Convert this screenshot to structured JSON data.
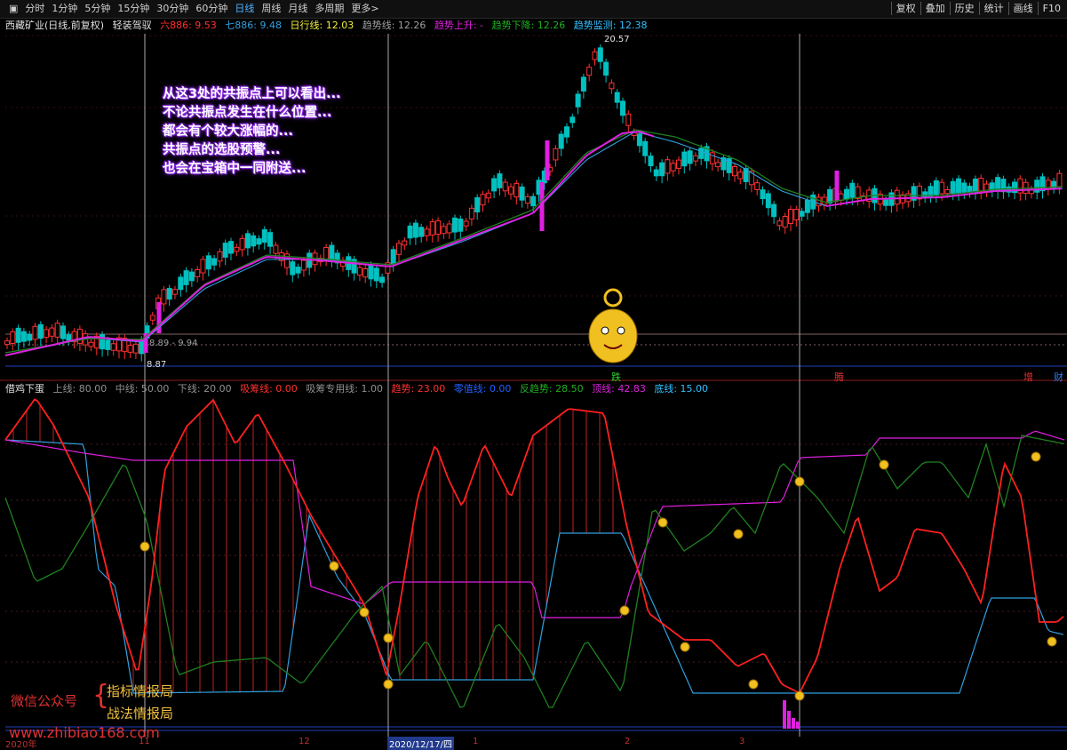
{
  "toolbar": {
    "items": [
      "分时",
      "1分钟",
      "5分钟",
      "15分钟",
      "30分钟",
      "60分钟",
      "日线",
      "周线",
      "月线",
      "多周期",
      "更多>"
    ],
    "active_index": 6,
    "right": [
      "复权",
      "叠加",
      "历史",
      "统计",
      "画线",
      "F10"
    ],
    "window_icon": "window-icon"
  },
  "upper_header": {
    "stock": "西藏矿业(日线,前复权)",
    "indicator": "轻装驾驭",
    "ma6": "六886: 9.53",
    "ma7": "七886: 9.48",
    "day": "日行线: 12.03",
    "trend": "趋势线: 12.26",
    "trend_up": "趋势上升: -",
    "trend_down": "趋势下降: 12.26",
    "trend_monitor": "趋势监测: 12.38"
  },
  "price_labels": {
    "high": "20.57",
    "low": "8.87",
    "mid": "8.89 - 9.94"
  },
  "overlay_lines": [
    "从这3处的共振点上可以看出...",
    "不论共振点发生在什么位置...",
    "都会有个较大涨幅的...",
    "共振点的选股预警...",
    "也会在宝箱中一同附送..."
  ],
  "events": [
    {
      "label": "跌",
      "color": "#30d030"
    },
    {
      "label": "腾",
      "color": "#e03030"
    },
    {
      "label": "增",
      "color": "#e03030"
    },
    {
      "label": "财",
      "color": "#2080ff"
    }
  ],
  "lower_header": {
    "name": "借鸡下蛋",
    "upper": "上线: 80.00",
    "mid": "中线: 50.00",
    "lower": "下线: 20.00",
    "absorb": "吸筹线: 0.00",
    "absorb2": "吸筹专用线: 1.00",
    "top": "趋势: 23.00",
    "zero": "零值线: 0.00",
    "counter": "反趋势: 28.50",
    "peak": "顶线: 42.83",
    "bottom": "底线: 15.00"
  },
  "watermark": {
    "left": "微信公众号",
    "right1": "指标情报局",
    "right2": "战法情报局",
    "url": "www.zhibiao168.com"
  },
  "axis": {
    "year": "2020年",
    "m11": "11",
    "m12": "12",
    "selected": "2020/12/17/四",
    "m1": "1",
    "m2": "2",
    "m3": "3"
  },
  "colors": {
    "up": "#ff3030",
    "down": "#00c0c0",
    "magenta": "#e020e0",
    "green": "#208020",
    "cyan": "#30a0e0"
  }
}
